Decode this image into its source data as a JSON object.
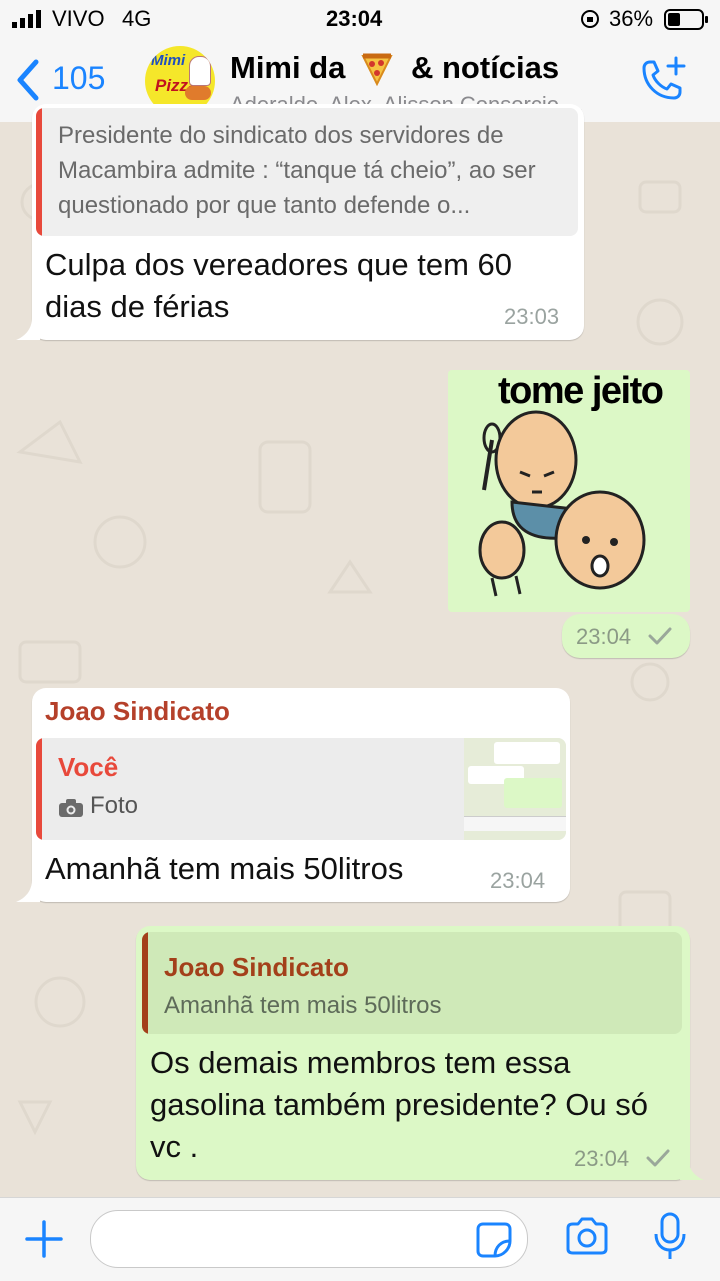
{
  "status_bar": {
    "carrier": "VIVO",
    "network": "4G",
    "time": "23:04",
    "battery": "36%"
  },
  "header": {
    "back_count": "105",
    "title_part1": "Mimi da",
    "title_part2": "& notícias",
    "subtitle": "Aderaldo, Alex, Alisson Consorcio,...",
    "avatar_text1": "Mimi",
    "avatar_text2": "Pizza"
  },
  "messages": {
    "m1": {
      "quote_text": "Presidente do sindicato dos servidores de Macambira admite : “tanque tá cheio”, ao ser questionado por que tanto defende o...",
      "text": "Culpa dos vereadores que tem 60 dias de férias",
      "time": "23:03"
    },
    "m2": {
      "sticker_caption": "tome jeito",
      "time": "23:04"
    },
    "m3": {
      "sender": "Joao Sindicato",
      "quote_author": "Você",
      "quote_label": "Foto",
      "text": "Amanhã tem mais 50litros",
      "time": "23:04"
    },
    "m4": {
      "quote_author": "Joao Sindicato",
      "quote_text": "Amanhã tem mais 50litros",
      "text": "Os demais membros tem essa gasolina também presidente? Ou só vc .",
      "time": "23:04"
    }
  },
  "colors": {
    "accent": "#1a84ff",
    "outgoing_bubble": "#dcf8c6",
    "incoming_bubble": "#ffffff",
    "sender_name": "#b5402a",
    "quote_red": "#e8493b",
    "quote_brown": "#a3401a"
  },
  "icons": {
    "back": "chevron-left-icon",
    "call": "add-call-icon",
    "attach": "plus-icon",
    "sticker": "sticker-icon",
    "camera": "camera-icon",
    "mic": "microphone-icon",
    "read_receipt": "check-icon"
  }
}
